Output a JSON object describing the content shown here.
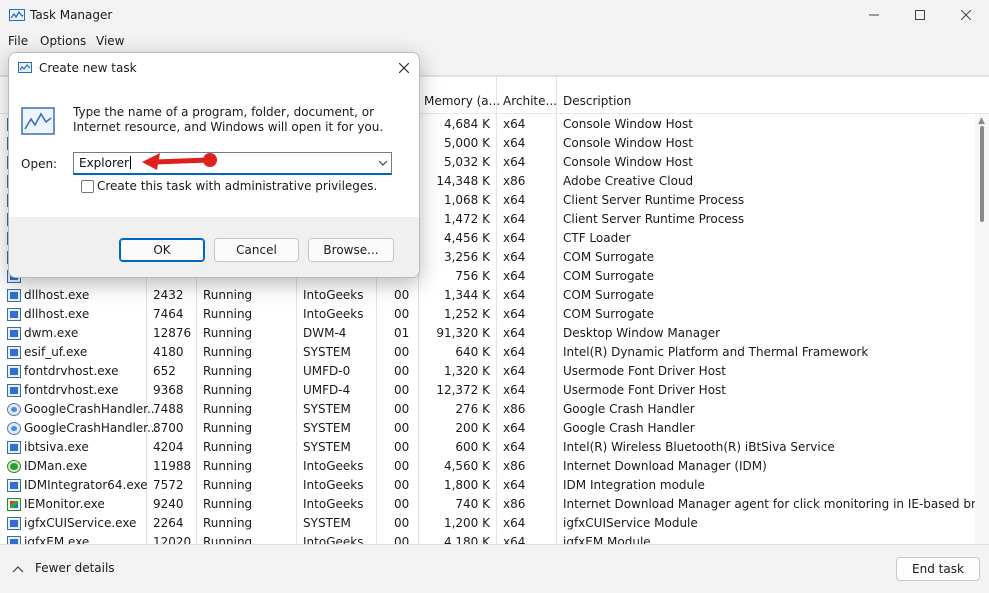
{
  "window": {
    "title": "Task Manager"
  },
  "menu": [
    "File",
    "Options",
    "View"
  ],
  "columns": {
    "memory": "Memory (a...",
    "architecture": "Archite...",
    "description": "Description"
  },
  "rows": [
    {
      "name": "",
      "pid": "",
      "status": "",
      "user": "",
      "cpu": "",
      "memory": "4,684 K",
      "arch": "x64",
      "desc": "Console Window Host",
      "icon": "console-icon"
    },
    {
      "name": "",
      "pid": "",
      "status": "",
      "user": "",
      "cpu": "",
      "memory": "5,000 K",
      "arch": "x64",
      "desc": "Console Window Host",
      "icon": "console-icon"
    },
    {
      "name": "",
      "pid": "",
      "status": "",
      "user": "",
      "cpu": "",
      "memory": "5,032 K",
      "arch": "x64",
      "desc": "Console Window Host",
      "icon": "console-icon"
    },
    {
      "name": "",
      "pid": "",
      "status": "",
      "user": "",
      "cpu": "",
      "memory": "14,348 K",
      "arch": "x86",
      "desc": "Adobe Creative Cloud",
      "icon": "adobe-icon"
    },
    {
      "name": "",
      "pid": "",
      "status": "",
      "user": "",
      "cpu": "",
      "memory": "1,068 K",
      "arch": "x64",
      "desc": "Client Server Runtime Process",
      "icon": "process-icon"
    },
    {
      "name": "",
      "pid": "",
      "status": "",
      "user": "",
      "cpu": "",
      "memory": "1,472 K",
      "arch": "x64",
      "desc": "Client Server Runtime Process",
      "icon": "process-icon"
    },
    {
      "name": "",
      "pid": "",
      "status": "",
      "user": "",
      "cpu": "",
      "memory": "4,456 K",
      "arch": "x64",
      "desc": "CTF Loader",
      "icon": "process-icon"
    },
    {
      "name": "",
      "pid": "",
      "status": "",
      "user": "",
      "cpu": "",
      "memory": "3,256 K",
      "arch": "x64",
      "desc": "COM Surrogate",
      "icon": "process-icon"
    },
    {
      "name": "",
      "pid": "",
      "status": "",
      "user": "",
      "cpu": "",
      "memory": "756 K",
      "arch": "x64",
      "desc": "COM Surrogate",
      "icon": "process-icon"
    },
    {
      "name": "dllhost.exe",
      "pid": "2432",
      "status": "Running",
      "user": "IntoGeeks",
      "cpu": "00",
      "memory": "1,344 K",
      "arch": "x64",
      "desc": "COM Surrogate",
      "icon": "process-icon"
    },
    {
      "name": "dllhost.exe",
      "pid": "7464",
      "status": "Running",
      "user": "IntoGeeks",
      "cpu": "00",
      "memory": "1,252 K",
      "arch": "x64",
      "desc": "COM Surrogate",
      "icon": "process-icon"
    },
    {
      "name": "dwm.exe",
      "pid": "12876",
      "status": "Running",
      "user": "DWM-4",
      "cpu": "01",
      "memory": "91,320 K",
      "arch": "x64",
      "desc": "Desktop Window Manager",
      "icon": "process-icon"
    },
    {
      "name": "esif_uf.exe",
      "pid": "4180",
      "status": "Running",
      "user": "SYSTEM",
      "cpu": "00",
      "memory": "640 K",
      "arch": "x64",
      "desc": "Intel(R) Dynamic Platform and Thermal Framework",
      "icon": "process-icon"
    },
    {
      "name": "fontdrvhost.exe",
      "pid": "652",
      "status": "Running",
      "user": "UMFD-0",
      "cpu": "00",
      "memory": "1,320 K",
      "arch": "x64",
      "desc": "Usermode Font Driver Host",
      "icon": "process-icon"
    },
    {
      "name": "fontdrvhost.exe",
      "pid": "9368",
      "status": "Running",
      "user": "UMFD-4",
      "cpu": "00",
      "memory": "12,372 K",
      "arch": "x64",
      "desc": "Usermode Font Driver Host",
      "icon": "process-icon"
    },
    {
      "name": "GoogleCrashHandler...",
      "pid": "7488",
      "status": "Running",
      "user": "SYSTEM",
      "cpu": "00",
      "memory": "276 K",
      "arch": "x86",
      "desc": "Google Crash Handler",
      "icon": "crash-handler-icon"
    },
    {
      "name": "GoogleCrashHandler...",
      "pid": "8700",
      "status": "Running",
      "user": "SYSTEM",
      "cpu": "00",
      "memory": "200 K",
      "arch": "x64",
      "desc": "Google Crash Handler",
      "icon": "crash-handler-icon"
    },
    {
      "name": "ibtsiva.exe",
      "pid": "4204",
      "status": "Running",
      "user": "SYSTEM",
      "cpu": "00",
      "memory": "600 K",
      "arch": "x64",
      "desc": "Intel(R) Wireless Bluetooth(R) iBtSiva Service",
      "icon": "process-icon"
    },
    {
      "name": "IDMan.exe",
      "pid": "11988",
      "status": "Running",
      "user": "IntoGeeks",
      "cpu": "00",
      "memory": "4,560 K",
      "arch": "x86",
      "desc": "Internet Download Manager (IDM)",
      "icon": "idm-icon"
    },
    {
      "name": "IDMIntegrator64.exe",
      "pid": "7572",
      "status": "Running",
      "user": "IntoGeeks",
      "cpu": "00",
      "memory": "1,800 K",
      "arch": "x64",
      "desc": "IDM Integration module",
      "icon": "process-icon"
    },
    {
      "name": "IEMonitor.exe",
      "pid": "9240",
      "status": "Running",
      "user": "IntoGeeks",
      "cpu": "00",
      "memory": "740 K",
      "arch": "x86",
      "desc": "Internet Download Manager agent for click monitoring in IE-based browsers",
      "icon": "ie-monitor-icon"
    },
    {
      "name": "igfxCUIService.exe",
      "pid": "2264",
      "status": "Running",
      "user": "SYSTEM",
      "cpu": "00",
      "memory": "1,200 K",
      "arch": "x64",
      "desc": "igfxCUIService Module",
      "icon": "process-icon"
    },
    {
      "name": "igfxEM.exe",
      "pid": "12020",
      "status": "Running",
      "user": "IntoGeeks",
      "cpu": "00",
      "memory": "4,180 K",
      "arch": "x64",
      "desc": "igfxEM Module",
      "icon": "process-icon"
    }
  ],
  "footer": {
    "fewer_details": "Fewer details",
    "end_task": "End task"
  },
  "dialog": {
    "title": "Create new task",
    "description": "Type the name of a program, folder, document, or Internet resource, and Windows will open it for you.",
    "open_label": "Open:",
    "open_value": "Explorer",
    "admin_checkbox_label": "Create this task with administrative privileges.",
    "admin_checked": false,
    "ok": "OK",
    "cancel": "Cancel",
    "browse": "Browse..."
  },
  "colors": {
    "accent": "#0067c0",
    "annotation_arrow": "#e0201b"
  }
}
